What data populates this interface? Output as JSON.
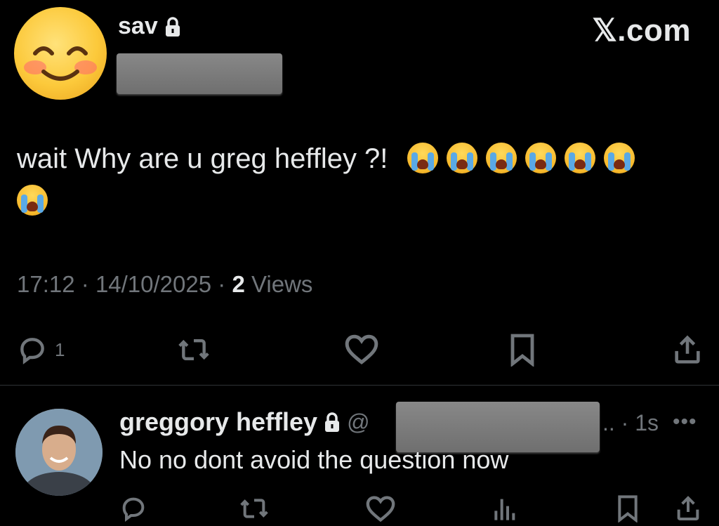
{
  "header": {
    "username": "sav",
    "brand": "𝕏.com"
  },
  "tweet": {
    "text": "wait Why are u greg heffley ?!",
    "crying_emoji_count": 7,
    "time": "17:12",
    "date": "14/10/2025",
    "views_count": "2",
    "views_label": "Views",
    "separator": "·",
    "reply_count": "1"
  },
  "reply": {
    "name": "greggory heffley",
    "handle_prefix": "@",
    "handle_suffix": "..",
    "time": "· 1s",
    "more": "•••",
    "text": "No no dont avoid the question now"
  },
  "icons": {
    "reply": "reply-icon",
    "retweet": "retweet-icon",
    "like": "heart-icon",
    "bookmark": "bookmark-icon",
    "share": "share-icon",
    "views": "views-icon",
    "lock": "lock-icon"
  },
  "colors": {
    "background": "#000000",
    "text": "#e7e9ea",
    "muted": "#71767b",
    "divider": "#2f3336"
  }
}
